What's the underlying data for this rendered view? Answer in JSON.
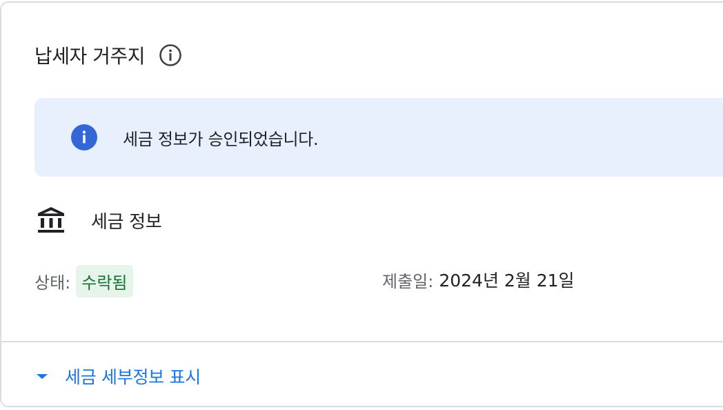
{
  "header": {
    "title": "납세자 거주지",
    "info_icon": "info-outline-icon"
  },
  "banner": {
    "icon": "info-filled-icon",
    "message": "세금 정보가 승인되었습니다."
  },
  "section": {
    "icon": "bank-icon",
    "title": "세금 정보"
  },
  "status": {
    "label": "상태:",
    "value": "수락됨",
    "chip_bg": "#e6f4ea",
    "chip_color": "#137333"
  },
  "submitted": {
    "label": "제출일:",
    "value": "2024년 2월 21일"
  },
  "expand": {
    "icon": "caret-down-icon",
    "label": "세금 세부정보 표시"
  },
  "colors": {
    "accent": "#1a73e8",
    "banner_bg": "#e8f0fe",
    "info_icon": "#3367d6",
    "border": "#dadce0"
  }
}
